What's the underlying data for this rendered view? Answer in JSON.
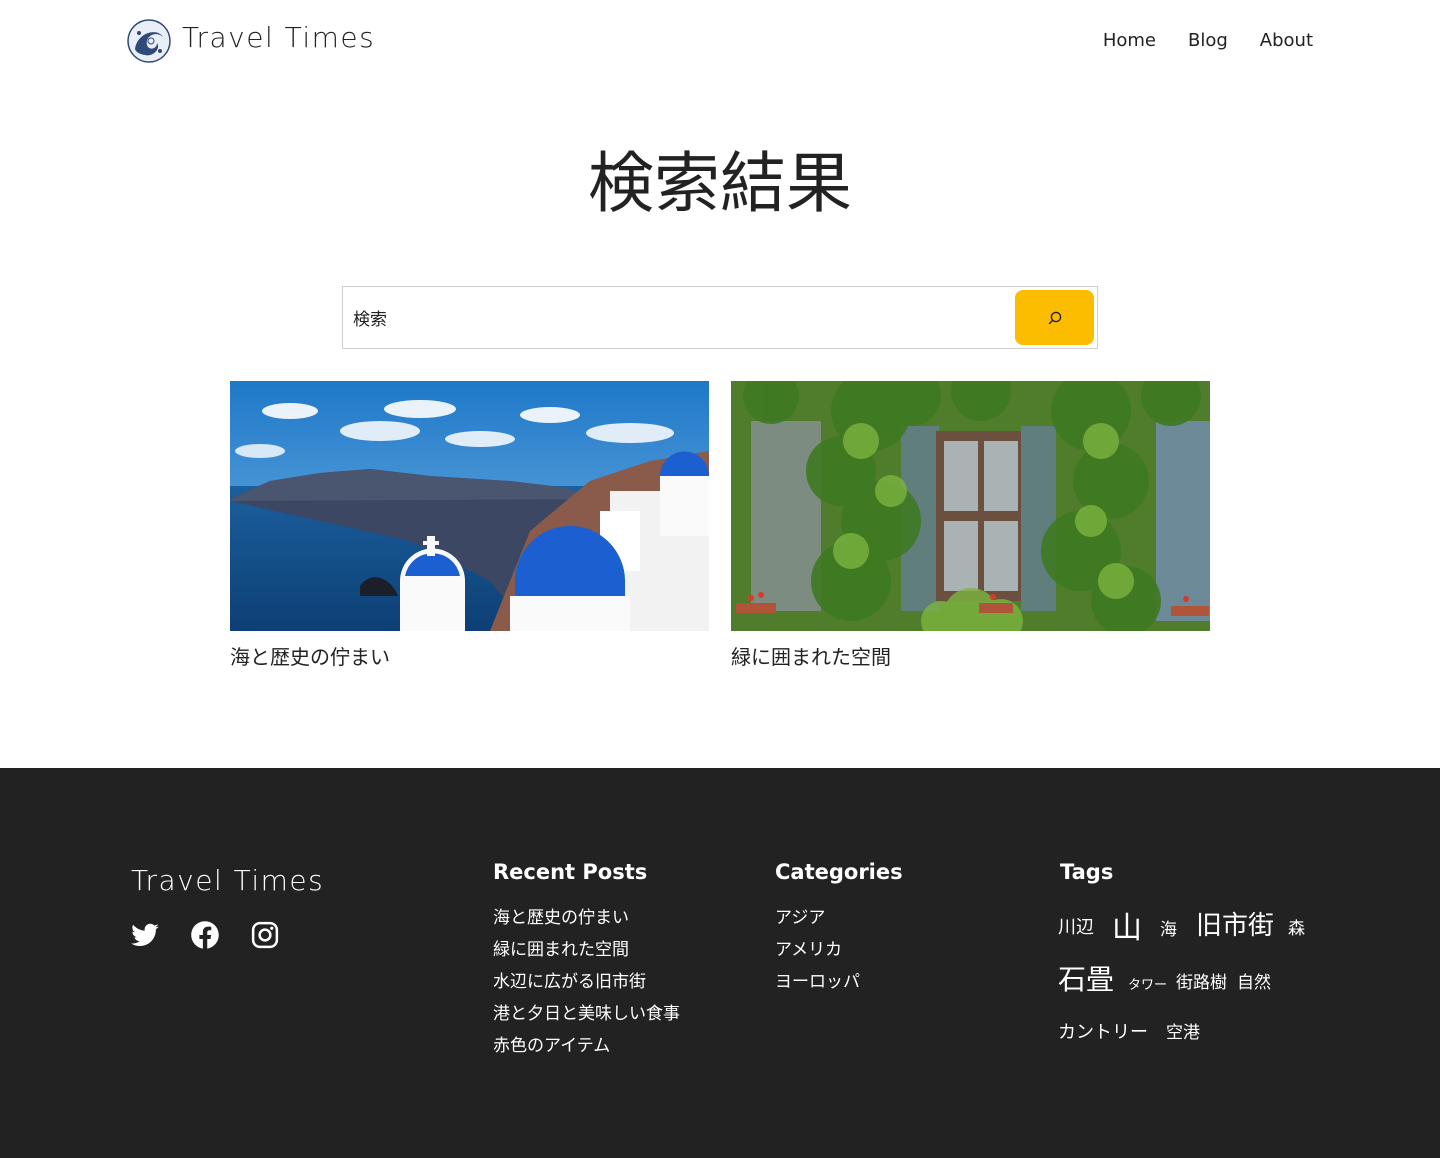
{
  "header": {
    "site_title": "Travel Times",
    "logo_icon": "wave-logo-icon",
    "nav": [
      {
        "label": "Home"
      },
      {
        "label": "Blog"
      },
      {
        "label": "About"
      }
    ]
  },
  "main": {
    "page_title": "検索結果",
    "search": {
      "value": "検索",
      "button_icon": "search-icon",
      "button_color": "#fcbd00"
    },
    "posts": [
      {
        "title": "海と歴史の佇まい",
        "image": "santorini-blue-domes-sea-photo"
      },
      {
        "title": "緑に囲まれた空間",
        "image": "ivy-covered-window-photo"
      }
    ]
  },
  "footer": {
    "background": "#222222",
    "site_title": "Travel Times",
    "social": [
      {
        "icon": "twitter-icon"
      },
      {
        "icon": "facebook-icon"
      },
      {
        "icon": "instagram-icon"
      }
    ],
    "recent_posts": {
      "heading": "Recent Posts",
      "items": [
        "海と歴史の佇まい",
        "緑に囲まれた空間",
        "水辺に広がる旧市街",
        "港と夕日と美味しい食事",
        "赤色のアイテム"
      ]
    },
    "categories": {
      "heading": "Categories",
      "items": [
        "アジア",
        "アメリカ",
        "ヨーロッパ"
      ]
    },
    "tags": {
      "heading": "Tags",
      "items": [
        "川辺",
        "山",
        "海",
        "旧市街",
        "森",
        "石畳",
        "タワー",
        "街路樹",
        "自然",
        "カントリー",
        "空港"
      ]
    }
  }
}
